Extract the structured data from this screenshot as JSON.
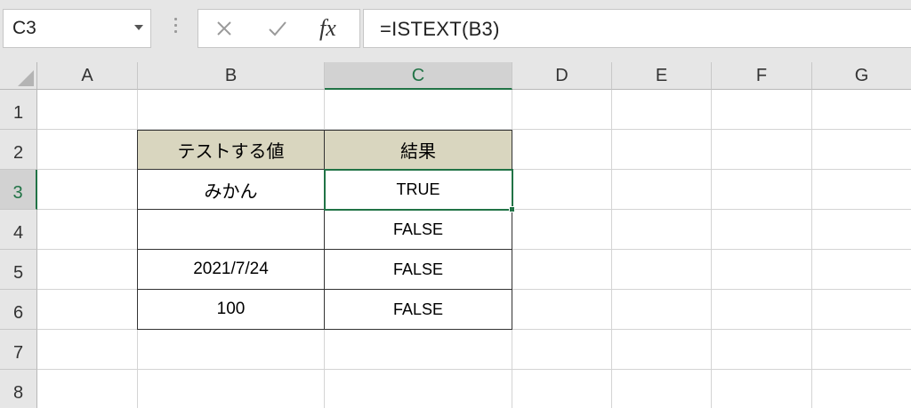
{
  "name_box": {
    "value": "C3"
  },
  "formula_bar": {
    "fx_label": "fx",
    "formula": "=ISTEXT(B3)"
  },
  "columns": [
    "A",
    "B",
    "C",
    "D",
    "E",
    "F",
    "G"
  ],
  "rows": [
    "1",
    "2",
    "3",
    "4",
    "5",
    "6",
    "7",
    "8"
  ],
  "selected": {
    "column": "C",
    "row": "3",
    "cell": "C3"
  },
  "table": {
    "headers": [
      "テストする値",
      "結果"
    ],
    "rows": [
      [
        "みかん",
        "TRUE"
      ],
      [
        "",
        "FALSE"
      ],
      [
        "2021/7/24",
        "FALSE"
      ],
      [
        "100",
        "FALSE"
      ]
    ]
  },
  "colors": {
    "accent": "#217346",
    "table_header_fill": "#d9d6bf"
  },
  "icons": [
    "dropdown-arrow-icon",
    "kebab-icon",
    "cancel-icon",
    "enter-icon",
    "fx-icon",
    "select-all-icon"
  ]
}
